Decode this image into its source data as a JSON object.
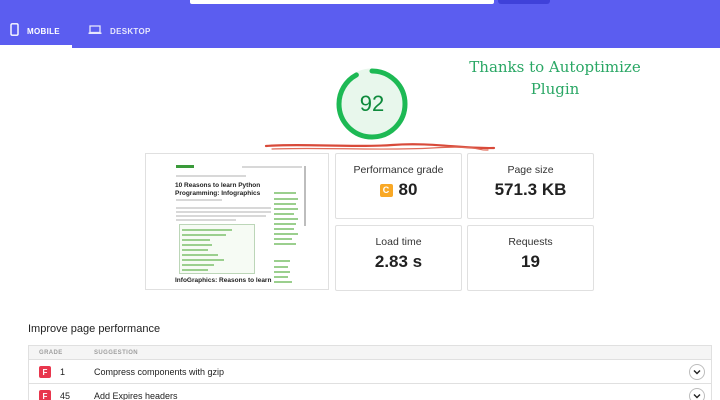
{
  "tabs": [
    {
      "label": "MOBILE",
      "icon": "phone-icon",
      "active": true
    },
    {
      "label": "DESKTOP",
      "icon": "laptop-icon",
      "active": false
    }
  ],
  "score": {
    "value": "92",
    "fraction": 0.92,
    "color": "#1db954"
  },
  "annotation": {
    "line1": "Thanks to Autoptimize",
    "line2": "Plugin"
  },
  "preview": {
    "site_name": "",
    "post_title": "10 Reasons to learn Python Programming: Infographics",
    "post_title_2": "InfoGraphics: Reasons to learn"
  },
  "metrics": {
    "performance": {
      "label": "Performance grade",
      "grade": "C",
      "value": "80",
      "grade_color": "#f9a825"
    },
    "page_size": {
      "label": "Page size",
      "value": "571.3 KB"
    },
    "load_time": {
      "label": "Load time",
      "value": "2.83 s"
    },
    "requests": {
      "label": "Requests",
      "value": "19"
    }
  },
  "improve": {
    "title": "Improve page performance",
    "headers": {
      "grade": "GRADE",
      "suggestion": "SUGGESTION"
    },
    "rows": [
      {
        "grade": "F",
        "count": "1",
        "suggestion": "Compress components with gzip"
      },
      {
        "grade": "F",
        "count": "45",
        "suggestion": "Add Expires headers"
      }
    ]
  }
}
